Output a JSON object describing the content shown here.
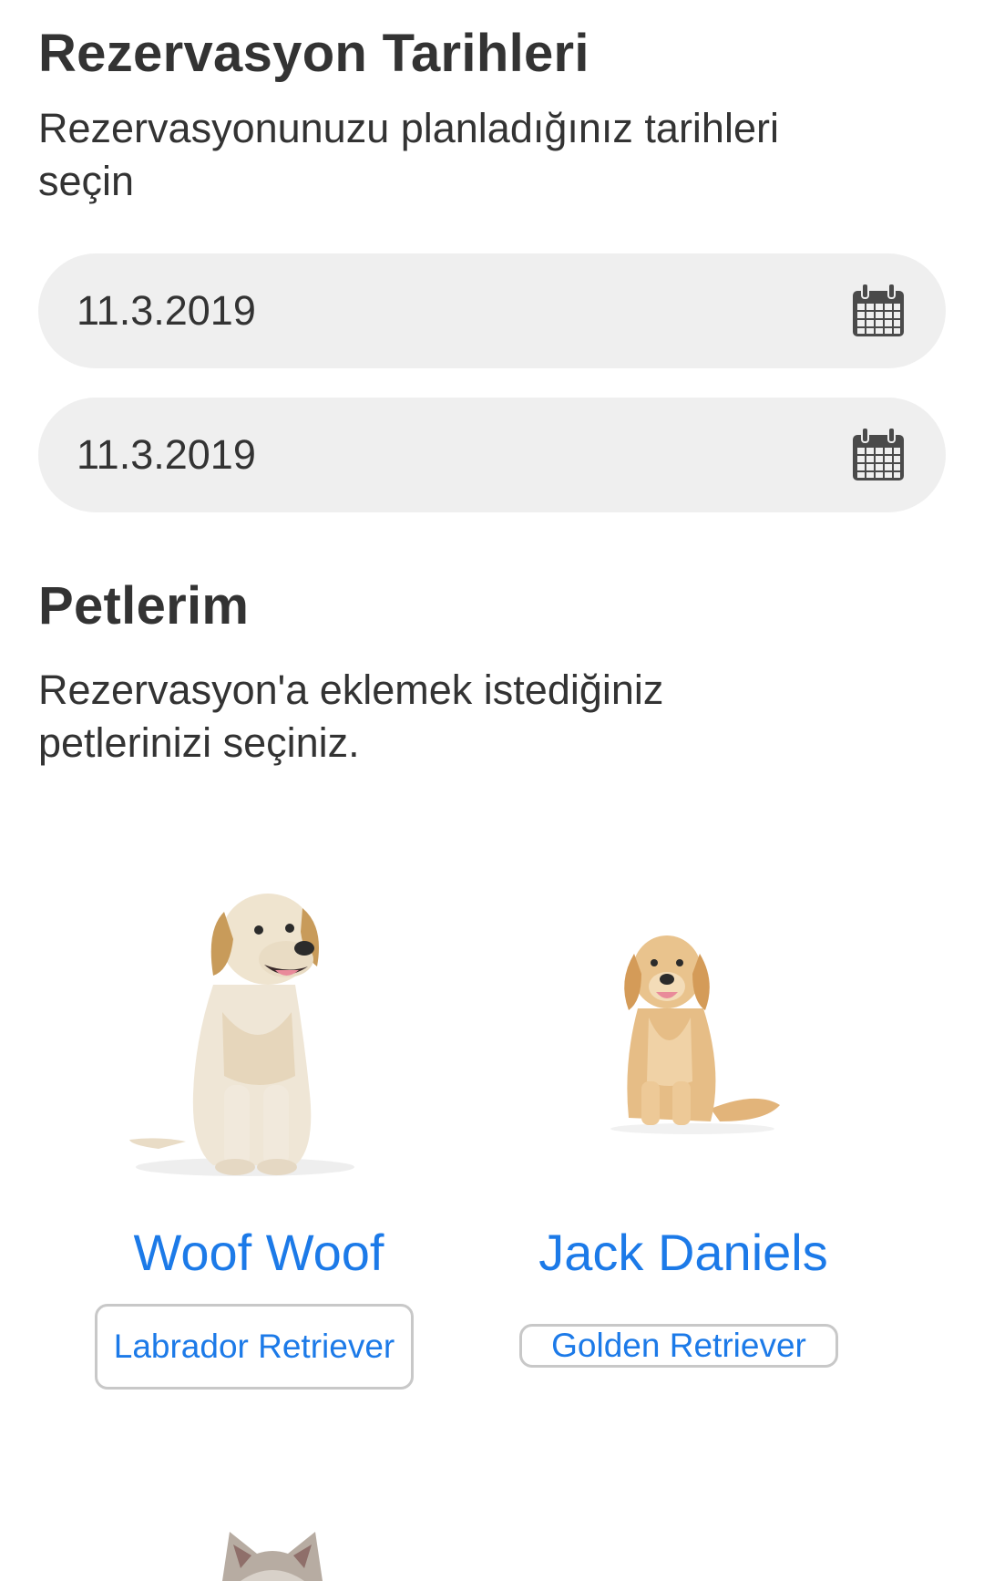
{
  "dates": {
    "title": "Rezervasyon Tarihleri",
    "description": "Rezervasyonunuzu planladığınız tarihleri seçin",
    "start_date": "11.3.2019",
    "end_date": "11.3.2019",
    "field_icon": "calendar-icon"
  },
  "pets": {
    "title": "Petlerim",
    "description": "Rezervasyon'a eklemek istediğiniz petlerinizi seçiniz.",
    "items": [
      {
        "name": "Woof Woof",
        "breed": "Labrador Retriever",
        "photo": "labrador-dog-photo"
      },
      {
        "name": "Jack Daniels",
        "breed": "Golden Retriever",
        "photo": "golden-retriever-dog-photo"
      },
      {
        "name": "",
        "breed": "",
        "photo": "cat-photo"
      }
    ]
  },
  "colors": {
    "accent": "#1c7ae8",
    "field_background": "#efefef",
    "text": "#333333"
  }
}
